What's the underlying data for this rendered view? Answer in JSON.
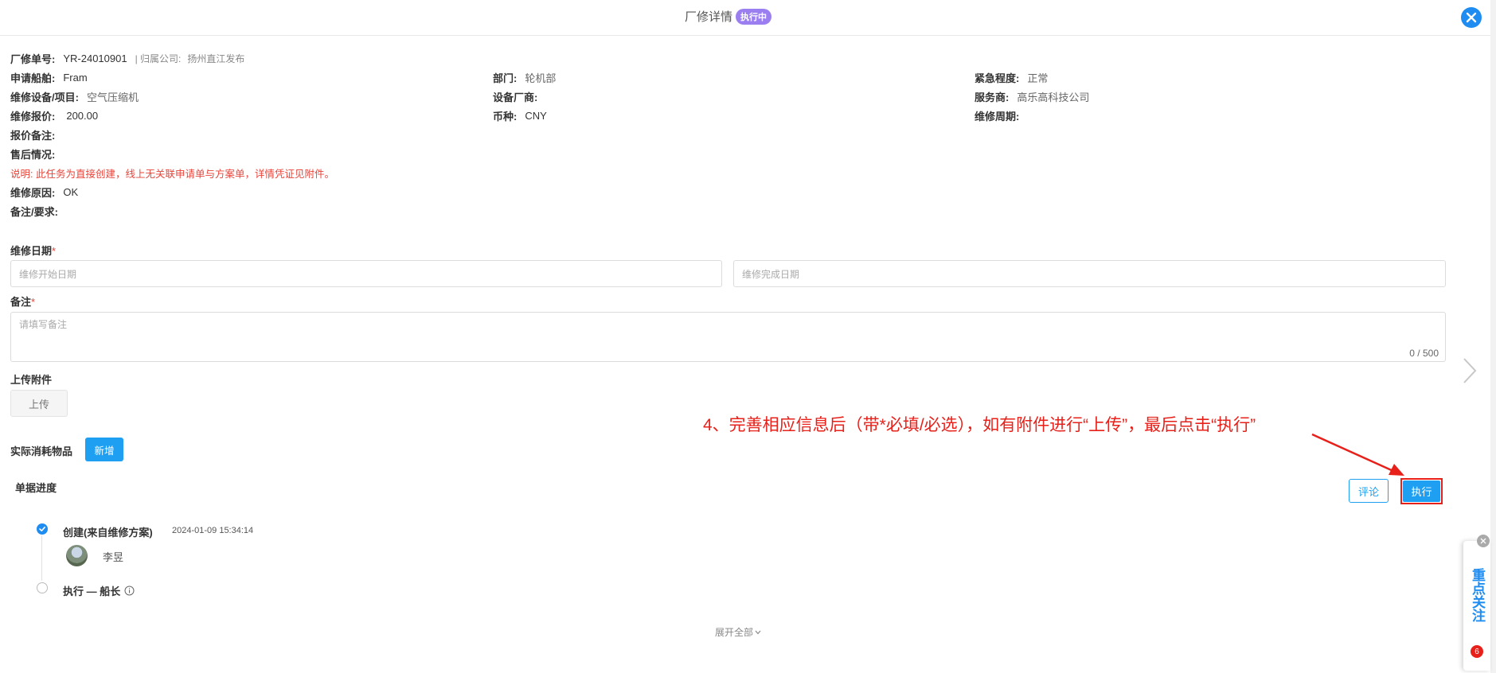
{
  "header": {
    "title": "厂修详情",
    "status_badge": "执行中"
  },
  "info": {
    "order_no_label": "厂修单号:",
    "order_no": "YR-24010901",
    "company_label": "| 归属公司:",
    "company": "扬州直江发布",
    "ship_label": "申请船舶:",
    "ship": "Fram",
    "dept_label": "部门:",
    "dept": "轮机部",
    "urgency_label": "紧急程度:",
    "urgency": "正常",
    "equipment_label": "维修设备/项目:",
    "equipment": "空气压缩机",
    "manufacturer_label": "设备厂商:",
    "manufacturer": "",
    "service_label": "服务商:",
    "service": "高乐高科技公司",
    "quote_label": "维修报价:",
    "quote": "200.00",
    "currency_label": "币种:",
    "currency": "CNY",
    "cycle_label": "维修周期:",
    "cycle": "",
    "quote_note_label": "报价备注:",
    "after_sales_label": "售后情况:",
    "note": "说明: 此任务为直接创建，线上无关联申请单与方案单，详情凭证见附件。",
    "reason_label": "维修原因:",
    "reason": "OK",
    "remark_label": "备注/要求:"
  },
  "form": {
    "date_label": "维修日期",
    "required_mark": "*",
    "start_placeholder": "维修开始日期",
    "end_placeholder": "维修完成日期",
    "remark_label": "备注",
    "remark_placeholder": "请填写备注",
    "counter": "0 / 500",
    "attachment_label": "上传附件",
    "upload_button": "上传",
    "consumables_label": "实际消耗物品",
    "add_button": "新增"
  },
  "progress": {
    "title": "单据进度",
    "comment_button": "评论",
    "execute_button": "执行",
    "steps": [
      {
        "title": "创建(来自维修方案)",
        "time": "2024-01-09 15:34:14",
        "user": "李昱"
      },
      {
        "title": "执行 — 船长"
      }
    ],
    "expand_all": "展开全部"
  },
  "annotation": {
    "text": "4、完善相应信息后（带*必填/必选），如有附件进行“上传”，最后点击“执行”"
  },
  "focus_panel": {
    "text": "重点关注",
    "count": "6"
  },
  "colors": {
    "primary": "#1e9ff2",
    "badge": "#9b7ff0",
    "alert_red": "#e8201a",
    "note_red": "#e8443a"
  }
}
